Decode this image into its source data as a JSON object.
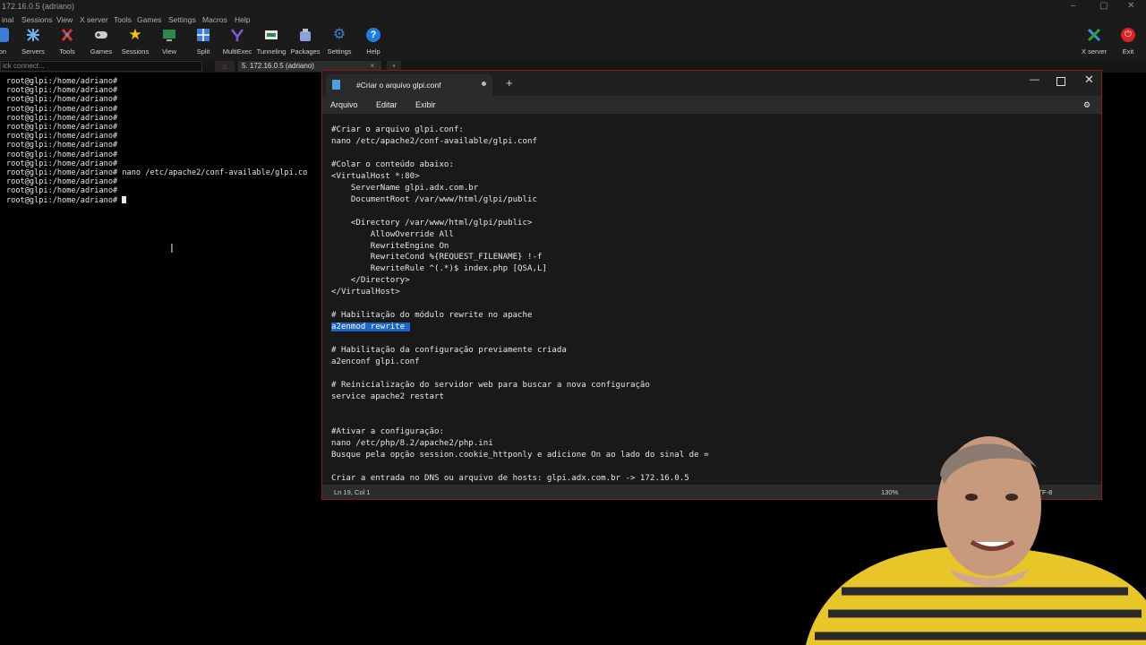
{
  "window": {
    "title": "172.16.0.5 (adriano)"
  },
  "menubar": {
    "items": [
      "inal",
      "Sessions",
      "View",
      "X server",
      "Tools",
      "Games",
      "Settings",
      "Macros",
      "Help"
    ]
  },
  "toolbar": {
    "buttons": [
      {
        "label": "ion",
        "icon": "session-icon"
      },
      {
        "label": "Servers",
        "icon": "servers-icon"
      },
      {
        "label": "Tools",
        "icon": "tools-icon"
      },
      {
        "label": "Games",
        "icon": "gamepad-icon"
      },
      {
        "label": "Sessions",
        "icon": "star-icon"
      },
      {
        "label": "View",
        "icon": "view-icon"
      },
      {
        "label": "Split",
        "icon": "split-icon"
      },
      {
        "label": "MultiExec",
        "icon": "multiexec-icon"
      },
      {
        "label": "Tunneling",
        "icon": "tunneling-icon"
      },
      {
        "label": "Packages",
        "icon": "packages-icon"
      },
      {
        "label": "Settings",
        "icon": "settings-icon"
      },
      {
        "label": "Help",
        "icon": "help-icon"
      }
    ],
    "xserver_label": "X server",
    "exit_label": "Exit"
  },
  "tabs": {
    "quick_connect_placeholder": "ick connect...",
    "session_tab_label": "5. 172.16.0.5 (adriano)"
  },
  "terminal": {
    "lines": [
      "root@glpi:/home/adriano#",
      "root@glpi:/home/adriano#",
      "root@glpi:/home/adriano#",
      "root@glpi:/home/adriano#",
      "root@glpi:/home/adriano#",
      "root@glpi:/home/adriano#",
      "root@glpi:/home/adriano#",
      "root@glpi:/home/adriano#",
      "root@glpi:/home/adriano#",
      "root@glpi:/home/adriano#",
      "root@glpi:/home/adriano# nano /etc/apache2/conf-available/glpi.co",
      "root@glpi:/home/adriano#",
      "root@glpi:/home/adriano#",
      "root@glpi:/home/adriano# "
    ]
  },
  "notepad": {
    "tab_title": "#Criar o arquivo glpi.conf",
    "menu": [
      "Arquivo",
      "Editar",
      "Exibir"
    ],
    "text_before_selection": "#Criar o arquivo glpi.conf:\nnano /etc/apache2/conf-available/glpi.conf\n\n#Colar o conteúdo abaixo:\n<VirtualHost *:80>\n    ServerName glpi.adx.com.br\n    DocumentRoot /var/www/html/glpi/public\n\n    <Directory /var/www/html/glpi/public>\n        AllowOverride All\n        RewriteEngine On\n        RewriteCond %{REQUEST_FILENAME} !-f\n        RewriteRule ^(.*)$ index.php [QSA,L]\n    </Directory>\n</VirtualHost>\n\n# Habilitação do módulo rewrite no apache\n",
    "selected_text": "a2enmod rewrite ",
    "text_after_selection": "\n\n# Habilitação da configuração previamente criada\na2enconf glpi.conf\n\n# Reinicialização do servidor web para buscar a nova configuração\nservice apache2 restart\n\n\n#Ativar a configuração:\nnano /etc/php/8.2/apache2/php.ini\nBusque pela opção session.cookie_httponly e adicione On ao lado do sinal de =\n\nCriar a entrada no DNS ou arquivo de hosts: glpi.adx.com.br -> 172.16.0.5",
    "status": {
      "position": "Ln 19, Col 1",
      "zoom": "130%",
      "encoding": "UTF-8"
    }
  },
  "colors": {
    "selection": "#1e63c8",
    "notepad_border": "#8a1a1a",
    "exit_red": "#e02020"
  }
}
